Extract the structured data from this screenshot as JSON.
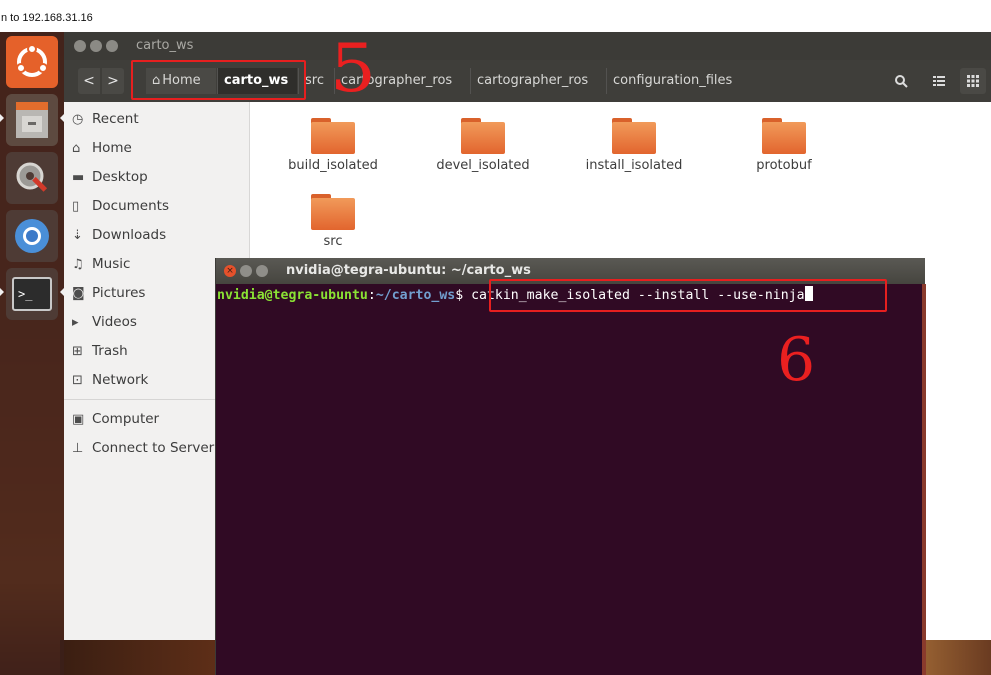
{
  "remote_title": "n to 192.168.31.16",
  "file_manager": {
    "title": "carto_ws",
    "nav": {
      "back": "<",
      "forward": ">"
    },
    "breadcrumbs": [
      "Home",
      "carto_ws",
      "src",
      "cartographer_ros",
      "cartographer_ros",
      "configuration_files"
    ],
    "sidebar": [
      {
        "label": "Recent",
        "icon": "clock-icon"
      },
      {
        "label": "Home",
        "icon": "home-icon"
      },
      {
        "label": "Desktop",
        "icon": "desktop-icon"
      },
      {
        "label": "Documents",
        "icon": "document-icon"
      },
      {
        "label": "Downloads",
        "icon": "download-icon"
      },
      {
        "label": "Music",
        "icon": "music-icon"
      },
      {
        "label": "Pictures",
        "icon": "camera-icon"
      },
      {
        "label": "Videos",
        "icon": "video-icon"
      },
      {
        "label": "Trash",
        "icon": "trash-icon"
      },
      {
        "label": "Network",
        "icon": "network-icon"
      },
      {
        "label": "Computer",
        "icon": "computer-icon"
      },
      {
        "label": "Connect to Server",
        "icon": "server-icon"
      }
    ],
    "folders": [
      "build_isolated",
      "devel_isolated",
      "install_isolated",
      "protobuf",
      "src"
    ]
  },
  "terminal": {
    "title": "nvidia@tegra-ubuntu: ~/carto_ws",
    "prompt_user": "nvidia@tegra-ubuntu",
    "prompt_colon": ":",
    "prompt_path": "~/carto_ws",
    "prompt_dollar": "$ ",
    "command": "catkin_make_isolated --install --use-ninja"
  },
  "annotations": {
    "step5": "5",
    "step6": "6"
  },
  "colors": {
    "terminal_bg": "#300a24",
    "prompt_user": "#8ae234",
    "prompt_path": "#729fcf",
    "annotation": "#e61f1f",
    "folder": "#e2652e"
  }
}
